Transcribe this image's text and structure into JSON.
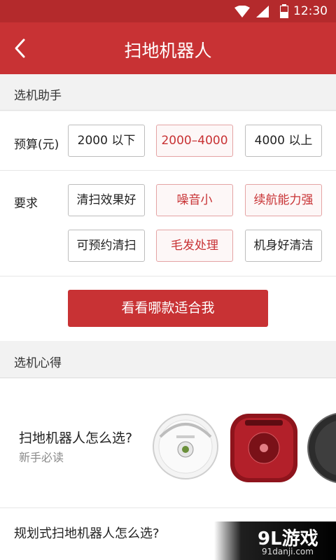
{
  "status_bar": {
    "time": "12:30",
    "icons": [
      "wifi-icon",
      "signal-icon",
      "battery-icon"
    ]
  },
  "header": {
    "title": "扫地机器人",
    "back_icon": "chevron-left-icon"
  },
  "assistant": {
    "title": "选机助手",
    "budget": {
      "label": "预算(元)",
      "options": [
        {
          "label": "2000 以下",
          "selected": false
        },
        {
          "label": "2000–4000",
          "selected": true
        },
        {
          "label": "4000 以上",
          "selected": false
        }
      ]
    },
    "requirements": {
      "label": "要求",
      "options": [
        {
          "label": "清扫效果好",
          "selected": false
        },
        {
          "label": "噪音小",
          "selected": true
        },
        {
          "label": "续航能力强",
          "selected": true
        },
        {
          "label": "可预约清扫",
          "selected": false
        },
        {
          "label": "毛发处理",
          "selected": true
        },
        {
          "label": "机身好清洁",
          "selected": false
        }
      ]
    },
    "submit_label": "看看哪款适合我"
  },
  "tips": {
    "title": "选机心得",
    "card": {
      "title": "扫地机器人怎么选?",
      "subtitle": "新手必读"
    },
    "list": [
      "规划式扫地机器人怎么选?"
    ]
  },
  "watermark": {
    "main": "9L游戏",
    "sub": "91danji.com"
  },
  "colors": {
    "primary": "#c83234",
    "status_bar": "#b42a2c",
    "selected_text": "#c83234"
  }
}
